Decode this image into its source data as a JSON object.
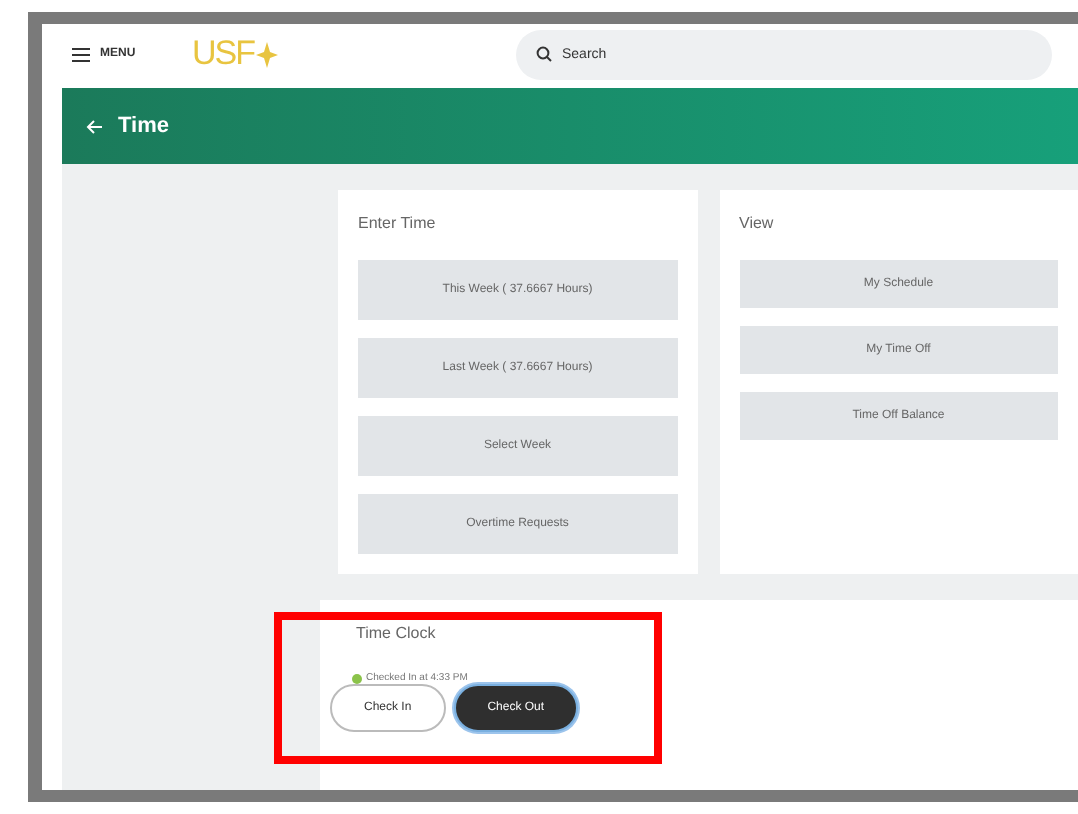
{
  "header": {
    "menu_label": "MENU",
    "logo": "USF",
    "search": {
      "placeholder": "Search"
    }
  },
  "page": {
    "title": "Time"
  },
  "enter_time": {
    "title": "Enter Time",
    "buttons": [
      "This Week ( 37.6667 Hours)",
      "Last Week ( 37.6667 Hours)",
      "Select Week",
      "Overtime Requests"
    ]
  },
  "view": {
    "title": "View",
    "buttons": [
      "My Schedule",
      "My Time Off",
      "Time Off Balance"
    ]
  },
  "time_clock": {
    "title": "Time Clock",
    "status": "Checked In at 4:33 PM",
    "buttons": [
      {
        "label": "Check In",
        "selected": false
      },
      {
        "label": "Check Out",
        "selected": true
      }
    ]
  },
  "highlight": {
    "kind": "red-rectangle"
  }
}
